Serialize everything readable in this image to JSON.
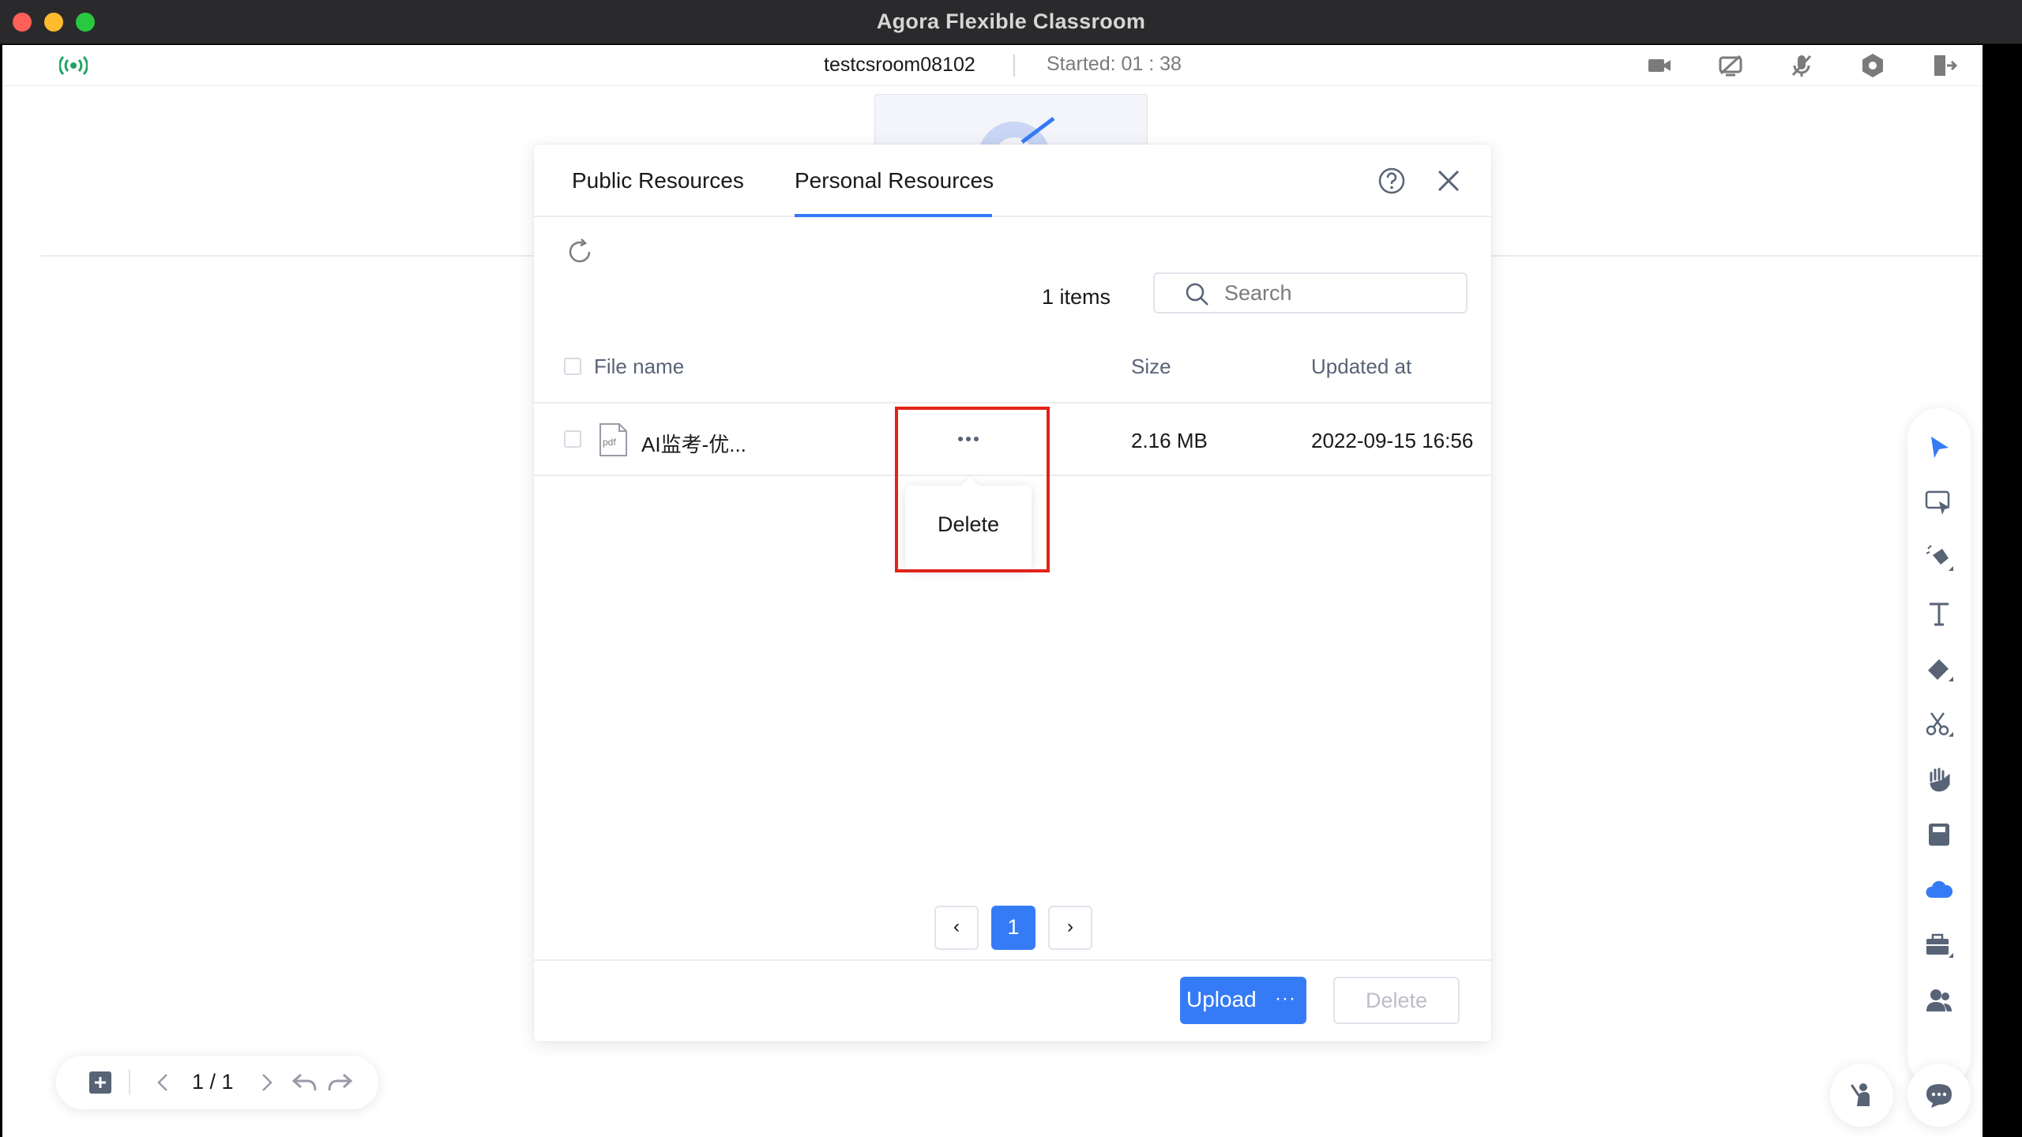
{
  "window": {
    "title": "Agora Flexible Classroom"
  },
  "topbar": {
    "room_name": "testcsroom08102",
    "started": "Started: 01 : 38",
    "icons": [
      "signal-icon",
      "camera-icon",
      "screen-share-off-icon",
      "mic-off-icon",
      "settings-hex-icon",
      "exit-icon"
    ]
  },
  "dialog": {
    "tabs": [
      {
        "label": "Public Resources",
        "active": false
      },
      {
        "label": "Personal Resources",
        "active": true
      }
    ],
    "count_text": "1 items",
    "search": {
      "placeholder": "Search",
      "value": ""
    },
    "columns": {
      "name": "File name",
      "size": "Size",
      "updated": "Updated at"
    },
    "rows": [
      {
        "name": "AI监考-优...",
        "type": "pdf",
        "size": "2.16 MB",
        "updated": "2022-09-15 16:56"
      }
    ],
    "row_menu": {
      "items": [
        "Delete"
      ]
    },
    "pager": {
      "prev": "‹",
      "current": "1",
      "next": "›"
    },
    "buttons": {
      "upload": "Upload",
      "upload_more": "···",
      "delete": "Delete"
    },
    "colors": {
      "accent": "#357bf6",
      "highlight": "#e2231a"
    }
  },
  "toolbar": {
    "tools": [
      "selector-icon",
      "laser-pointer-icon",
      "pen-icon",
      "text-icon",
      "eraser-icon",
      "clipper-icon",
      "hand-icon",
      "save-icon",
      "cloud-icon",
      "toolbox-icon",
      "roster-icon"
    ]
  },
  "pagebar": {
    "indicator": "1 / 1"
  }
}
